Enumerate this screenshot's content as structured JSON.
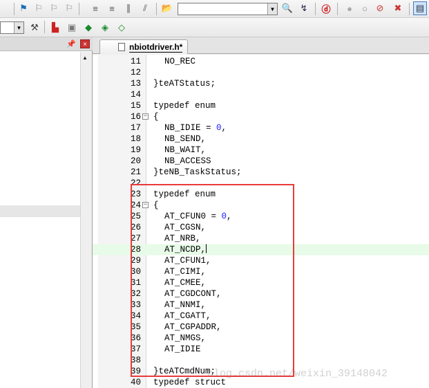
{
  "tab": {
    "label": "nbiotdriver.h*"
  },
  "left_pane": {
    "pin": "ᵖ",
    "close": "×"
  },
  "toolbar": {
    "search_combo_value": "",
    "left_combo_value": ""
  },
  "editor": {
    "lines": [
      {
        "num": "11",
        "code": "NO_REC",
        "indent": 2
      },
      {
        "num": "12",
        "code": "",
        "indent": 0
      },
      {
        "num": "13",
        "code": "}teATStatus;",
        "indent": 0
      },
      {
        "num": "14",
        "code": "",
        "indent": 0
      },
      {
        "num": "15",
        "code": "typedef enum",
        "indent": 0,
        "kw": true
      },
      {
        "num": "16",
        "code": "{",
        "indent": 0
      },
      {
        "num": "17",
        "code": "NB_IDIE = 0,",
        "indent": 2
      },
      {
        "num": "18",
        "code": "NB_SEND,",
        "indent": 2
      },
      {
        "num": "19",
        "code": "NB_WAIT,",
        "indent": 2
      },
      {
        "num": "20",
        "code": "NB_ACCESS",
        "indent": 2
      },
      {
        "num": "21",
        "code": "}teNB_TaskStatus;",
        "indent": 0
      },
      {
        "num": "22",
        "code": "",
        "indent": 0
      },
      {
        "num": "23",
        "code": "typedef enum",
        "indent": 0,
        "kw": true
      },
      {
        "num": "24",
        "code": "{",
        "indent": 0
      },
      {
        "num": "25",
        "code": "AT_CFUN0 = 0,",
        "indent": 2
      },
      {
        "num": "26",
        "code": "AT_CGSN,",
        "indent": 2
      },
      {
        "num": "27",
        "code": "AT_NRB,",
        "indent": 2
      },
      {
        "num": "28",
        "code": "AT_NCDP,",
        "indent": 2
      },
      {
        "num": "29",
        "code": "AT_CFUN1,",
        "indent": 2
      },
      {
        "num": "30",
        "code": "AT_CIMI,",
        "indent": 2
      },
      {
        "num": "31",
        "code": "AT_CMEE,",
        "indent": 2
      },
      {
        "num": "32",
        "code": "AT_CGDCONT,",
        "indent": 2
      },
      {
        "num": "33",
        "code": "AT_NNMI,",
        "indent": 2
      },
      {
        "num": "34",
        "code": "AT_CGATT,",
        "indent": 2
      },
      {
        "num": "35",
        "code": "AT_CGPADDR,",
        "indent": 2
      },
      {
        "num": "36",
        "code": "AT_NMGS,",
        "indent": 2
      },
      {
        "num": "37",
        "code": "AT_IDIE",
        "indent": 2
      },
      {
        "num": "38",
        "code": "",
        "indent": 0
      },
      {
        "num": "39",
        "code": "}teATCmdNum;",
        "indent": 0
      },
      {
        "num": "40",
        "code": "typedef struct",
        "indent": 0,
        "kw": true
      }
    ],
    "highlight_line": "28",
    "watermark": "blog.csdn.net/weixin_39148042"
  }
}
